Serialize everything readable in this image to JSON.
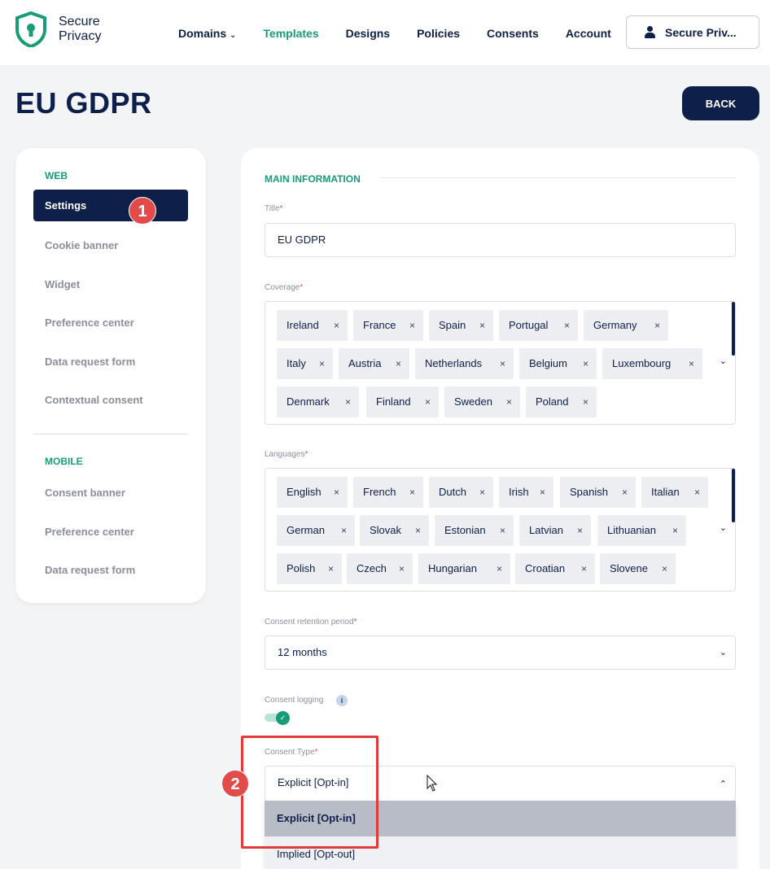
{
  "brand": {
    "line1": "Secure",
    "line2": "Privacy",
    "accent": "#179c77",
    "navy": "#0e1f4a"
  },
  "nav": {
    "items": [
      {
        "label": "Domains",
        "has_dropdown": true
      },
      {
        "label": "Templates",
        "active": true
      },
      {
        "label": "Designs"
      },
      {
        "label": "Policies"
      },
      {
        "label": "Consents"
      },
      {
        "label": "Account"
      }
    ],
    "account_label": "Secure Priv..."
  },
  "page": {
    "title": "EU GDPR",
    "back_label": "BACK"
  },
  "sidebar": {
    "web_heading": "WEB",
    "web_items": [
      "Settings",
      "Cookie banner",
      "Widget",
      "Preference center",
      "Data request form",
      "Contextual consent"
    ],
    "mobile_heading": "MOBILE",
    "mobile_items": [
      "Consent banner",
      "Preference center",
      "Data request form"
    ]
  },
  "main": {
    "section_title": "MAIN INFORMATION",
    "title_label": "Title",
    "title_value": "EU GDPR",
    "coverage_label": "Coverage",
    "coverage": [
      "Ireland",
      "France",
      "Spain",
      "Portugal",
      "Germany",
      "Italy",
      "Austria",
      "Netherlands",
      "Belgium",
      "Luxembourg",
      "Denmark",
      "Finland",
      "Sweden",
      "Poland"
    ],
    "languages_label": "Languages",
    "languages": [
      "English",
      "French",
      "Dutch",
      "Irish",
      "Spanish",
      "Italian",
      "German",
      "Slovak",
      "Estonian",
      "Latvian",
      "Lithuanian",
      "Polish",
      "Czech",
      "Hungarian",
      "Croatian",
      "Slovene"
    ],
    "retention_label": "Consent retention period",
    "retention_value": "12 months",
    "logging_label": "Consent logging",
    "logging_enabled": true,
    "consent_type_label": "Consent Type",
    "consent_type_value": "Explicit [Opt-in]",
    "consent_type_options": [
      "Explicit [Opt-in]",
      "Implied [Opt-out]"
    ]
  },
  "annotations": {
    "badge1": "1",
    "badge2": "2"
  },
  "glyphs": {
    "remove": "×",
    "caret_down": "⌄",
    "caret_up": "⌃",
    "check": "✓",
    "info": "i"
  }
}
